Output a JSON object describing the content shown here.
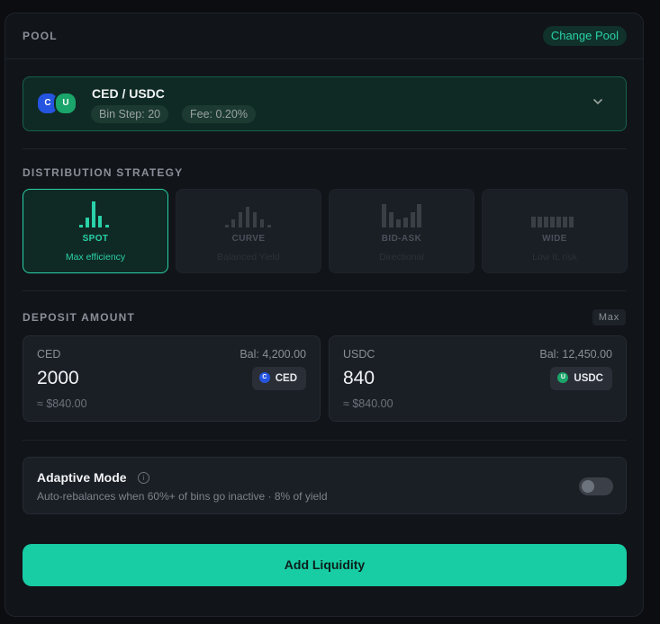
{
  "header": {
    "pool_label": "POOL",
    "change_pool_label": "Change Pool"
  },
  "pool": {
    "pair": "CED / USDC",
    "token_a_initial": "C",
    "token_b_initial": "U",
    "bin_step": "Bin Step: 20",
    "fee": "Fee: 0.20%",
    "expand_icon": "chevron-down-icon"
  },
  "distribution": {
    "label": "DISTRIBUTION STRATEGY",
    "selected": "SPOT",
    "strategies": [
      {
        "name": "SPOT",
        "desc": "Max efficiency",
        "icon": "spot-bars-icon"
      },
      {
        "name": "CURVE",
        "desc": "Balanced Yield",
        "icon": "curve-bars-icon"
      },
      {
        "name": "BID-ASK",
        "desc": "Directional",
        "icon": "bid-ask-bars-icon"
      },
      {
        "name": "WIDE",
        "desc": "Low IL risk",
        "icon": "wide-bars-icon"
      }
    ]
  },
  "deposit": {
    "label": "DEPOSIT AMOUNT",
    "max_label": "Max",
    "tokens": [
      {
        "symbol_label": "CED",
        "balance": "Bal: 4,200.00",
        "amount": "2000",
        "usd": "≈ $840.00",
        "token_button": "CED",
        "initial": "C",
        "color": "#2554e0"
      },
      {
        "symbol_label": "USDC",
        "balance": "Bal: 12,450.00",
        "amount": "840",
        "usd": "≈ $840.00",
        "token_button": "USDC",
        "initial": "U",
        "color": "#1aa56a"
      }
    ]
  },
  "adaptive": {
    "title": "Adaptive Mode",
    "info_glyph": "i",
    "description": "Auto-rebalances when 60%+ of bins go inactive · 8% of yield",
    "enabled": false
  },
  "action": {
    "add_liquidity_label": "Add Liquidity"
  },
  "colors": {
    "accent": "#18cca4",
    "accent_dark": "#0f2a24",
    "panel": "#111419"
  }
}
